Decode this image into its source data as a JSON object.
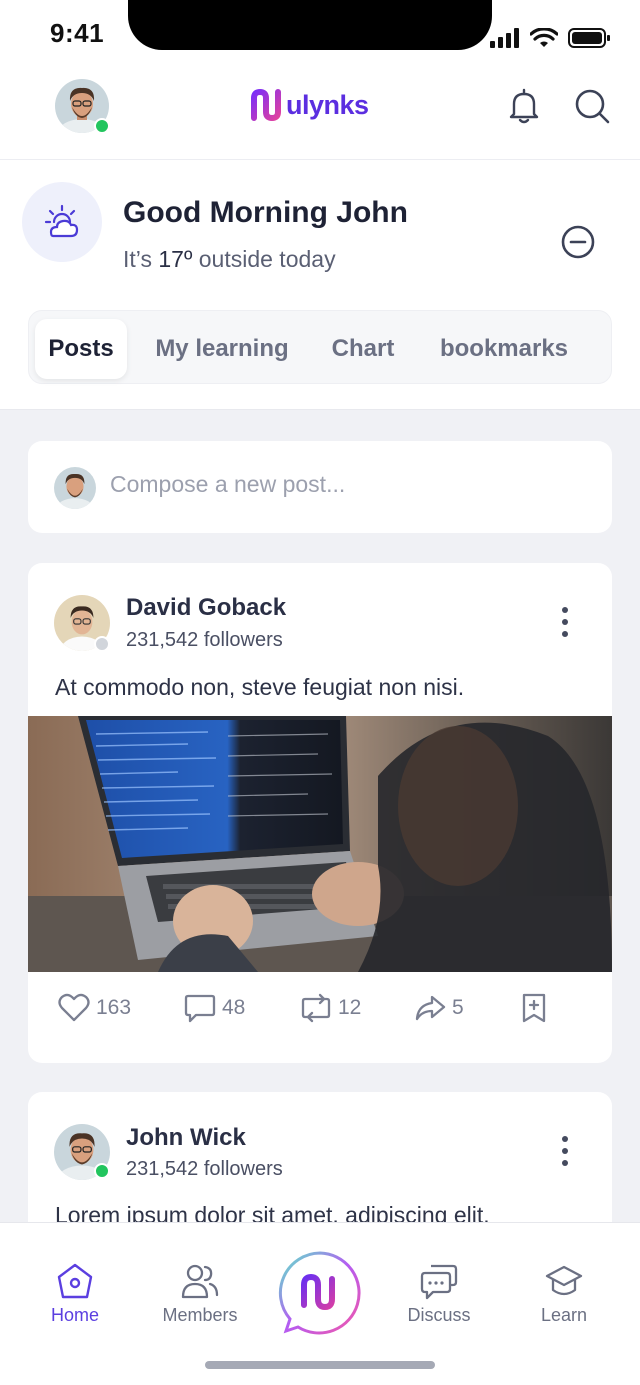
{
  "status_bar": {
    "time": "9:41"
  },
  "header": {
    "logo_text": "ulynks",
    "brand_color": "#5B2EE0",
    "icons": [
      "bell-icon",
      "search-icon"
    ]
  },
  "greeting": {
    "title": "Good Morning John",
    "subtitle_prefix": "It’s ",
    "temperature": "17º",
    "subtitle_suffix": " outside today",
    "weather_icon": "partly-cloudy-icon"
  },
  "tabs": [
    {
      "label": "Posts",
      "active": true
    },
    {
      "label": "My learning",
      "active": false
    },
    {
      "label": "Chart",
      "active": false
    },
    {
      "label": "bookmarks",
      "active": false
    }
  ],
  "compose": {
    "placeholder": "Compose a new post..."
  },
  "posts": [
    {
      "author": "David Goback",
      "followers": "231,542 followers",
      "online": false,
      "text": "At commodo non, steve feugiat non nisi.",
      "image": "laptop-coding-photo",
      "likes": "163",
      "comments": "48",
      "reposts": "12",
      "shares": "5"
    },
    {
      "author": "John Wick",
      "followers": "231,542 followers",
      "online": true,
      "text": "Lorem ipsum dolor sit amet, adipiscing elit."
    }
  ],
  "bottom_nav": [
    {
      "label": "Home",
      "icon": "home-icon",
      "active": true
    },
    {
      "label": "Members",
      "icon": "members-icon",
      "active": false
    },
    {
      "label": "Discuss",
      "icon": "discuss-icon",
      "active": false
    },
    {
      "label": "Learn",
      "icon": "learn-icon",
      "active": false
    }
  ],
  "colors": {
    "accent": "#5B3FE0",
    "online": "#22C55E",
    "background": "#F0F1F5"
  }
}
